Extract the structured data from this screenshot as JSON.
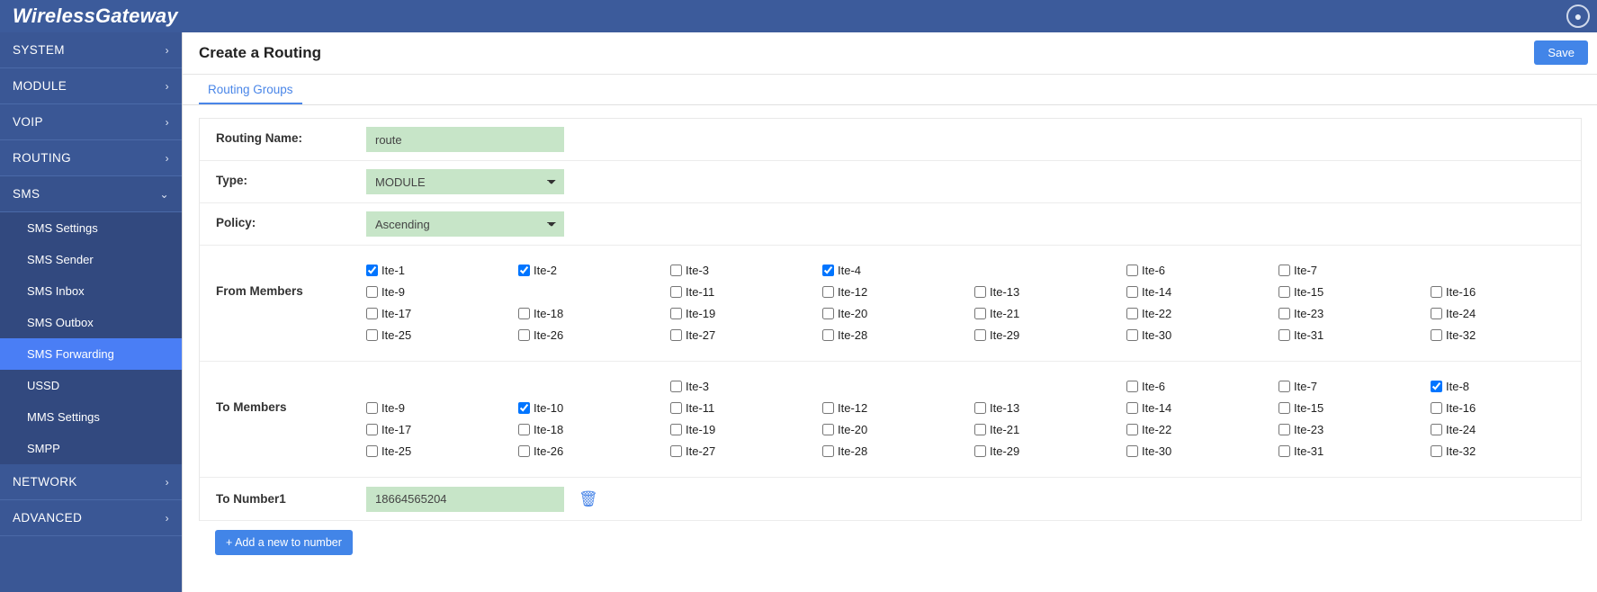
{
  "header": {
    "logo": "WirelessGateway",
    "user_icon": "user-circle-icon"
  },
  "sidebar": {
    "top_items": [
      {
        "label": "SYSTEM",
        "chevron": "›",
        "expanded": false
      },
      {
        "label": "MODULE",
        "chevron": "›",
        "expanded": false
      },
      {
        "label": "VOIP",
        "chevron": "›",
        "expanded": false
      },
      {
        "label": "ROUTING",
        "chevron": "›",
        "expanded": false
      },
      {
        "label": "SMS",
        "chevron": "⌄",
        "expanded": true
      }
    ],
    "sms_sub_items": [
      {
        "label": "SMS Settings",
        "active": false
      },
      {
        "label": "SMS Sender",
        "active": false
      },
      {
        "label": "SMS Inbox",
        "active": false
      },
      {
        "label": "SMS Outbox",
        "active": false
      },
      {
        "label": "SMS Forwarding",
        "active": true
      },
      {
        "label": "USSD",
        "active": false
      },
      {
        "label": "MMS Settings",
        "active": false
      },
      {
        "label": "SMPP",
        "active": false
      }
    ],
    "bottom_items": [
      {
        "label": "NETWORK",
        "chevron": "›"
      },
      {
        "label": "ADVANCED",
        "chevron": "›"
      }
    ]
  },
  "page": {
    "title": "Create a Routing",
    "save_label": "Save",
    "tab_label": "Routing Groups"
  },
  "form": {
    "routing_name_label": "Routing Name:",
    "routing_name_value": "route",
    "type_label": "Type:",
    "type_value": "MODULE",
    "type_options": [
      "MODULE"
    ],
    "policy_label": "Policy:",
    "policy_value": "Ascending",
    "policy_options": [
      "Ascending"
    ],
    "from_members_label": "From Members",
    "to_members_label": "To Members",
    "to_number_label": "To Number1",
    "to_number_value": "18664565204",
    "delete_icon": "trash-icon",
    "add_number_label": "+ Add a new to number"
  },
  "from_members": [
    {
      "label": "Ite-1",
      "checked": true,
      "empty": false
    },
    {
      "label": "Ite-2",
      "checked": true,
      "empty": false
    },
    {
      "label": "Ite-3",
      "checked": false,
      "empty": false
    },
    {
      "label": "Ite-4",
      "checked": true,
      "empty": false
    },
    {
      "label": "",
      "checked": false,
      "empty": true
    },
    {
      "label": "Ite-6",
      "checked": false,
      "empty": false
    },
    {
      "label": "Ite-7",
      "checked": false,
      "empty": false
    },
    {
      "label": "",
      "checked": false,
      "empty": true
    },
    {
      "label": "Ite-9",
      "checked": false,
      "empty": false
    },
    {
      "label": "",
      "checked": false,
      "empty": true
    },
    {
      "label": "Ite-11",
      "checked": false,
      "empty": false
    },
    {
      "label": "Ite-12",
      "checked": false,
      "empty": false
    },
    {
      "label": "Ite-13",
      "checked": false,
      "empty": false
    },
    {
      "label": "Ite-14",
      "checked": false,
      "empty": false
    },
    {
      "label": "Ite-15",
      "checked": false,
      "empty": false
    },
    {
      "label": "Ite-16",
      "checked": false,
      "empty": false
    },
    {
      "label": "Ite-17",
      "checked": false,
      "empty": false
    },
    {
      "label": "Ite-18",
      "checked": false,
      "empty": false
    },
    {
      "label": "Ite-19",
      "checked": false,
      "empty": false
    },
    {
      "label": "Ite-20",
      "checked": false,
      "empty": false
    },
    {
      "label": "Ite-21",
      "checked": false,
      "empty": false
    },
    {
      "label": "Ite-22",
      "checked": false,
      "empty": false
    },
    {
      "label": "Ite-23",
      "checked": false,
      "empty": false
    },
    {
      "label": "Ite-24",
      "checked": false,
      "empty": false
    },
    {
      "label": "Ite-25",
      "checked": false,
      "empty": false
    },
    {
      "label": "Ite-26",
      "checked": false,
      "empty": false
    },
    {
      "label": "Ite-27",
      "checked": false,
      "empty": false
    },
    {
      "label": "Ite-28",
      "checked": false,
      "empty": false
    },
    {
      "label": "Ite-29",
      "checked": false,
      "empty": false
    },
    {
      "label": "Ite-30",
      "checked": false,
      "empty": false
    },
    {
      "label": "Ite-31",
      "checked": false,
      "empty": false
    },
    {
      "label": "Ite-32",
      "checked": false,
      "empty": false
    }
  ],
  "to_members": [
    {
      "label": "",
      "checked": false,
      "empty": true
    },
    {
      "label": "",
      "checked": false,
      "empty": true
    },
    {
      "label": "Ite-3",
      "checked": false,
      "empty": false
    },
    {
      "label": "",
      "checked": false,
      "empty": true
    },
    {
      "label": "",
      "checked": false,
      "empty": true
    },
    {
      "label": "Ite-6",
      "checked": false,
      "empty": false
    },
    {
      "label": "Ite-7",
      "checked": false,
      "empty": false
    },
    {
      "label": "Ite-8",
      "checked": true,
      "empty": false
    },
    {
      "label": "Ite-9",
      "checked": false,
      "empty": false
    },
    {
      "label": "Ite-10",
      "checked": true,
      "empty": false
    },
    {
      "label": "Ite-11",
      "checked": false,
      "empty": false
    },
    {
      "label": "Ite-12",
      "checked": false,
      "empty": false
    },
    {
      "label": "Ite-13",
      "checked": false,
      "empty": false
    },
    {
      "label": "Ite-14",
      "checked": false,
      "empty": false
    },
    {
      "label": "Ite-15",
      "checked": false,
      "empty": false
    },
    {
      "label": "Ite-16",
      "checked": false,
      "empty": false
    },
    {
      "label": "Ite-17",
      "checked": false,
      "empty": false
    },
    {
      "label": "Ite-18",
      "checked": false,
      "empty": false
    },
    {
      "label": "Ite-19",
      "checked": false,
      "empty": false
    },
    {
      "label": "Ite-20",
      "checked": false,
      "empty": false
    },
    {
      "label": "Ite-21",
      "checked": false,
      "empty": false
    },
    {
      "label": "Ite-22",
      "checked": false,
      "empty": false
    },
    {
      "label": "Ite-23",
      "checked": false,
      "empty": false
    },
    {
      "label": "Ite-24",
      "checked": false,
      "empty": false
    },
    {
      "label": "Ite-25",
      "checked": false,
      "empty": false
    },
    {
      "label": "Ite-26",
      "checked": false,
      "empty": false
    },
    {
      "label": "Ite-27",
      "checked": false,
      "empty": false
    },
    {
      "label": "Ite-28",
      "checked": false,
      "empty": false
    },
    {
      "label": "Ite-29",
      "checked": false,
      "empty": false
    },
    {
      "label": "Ite-30",
      "checked": false,
      "empty": false
    },
    {
      "label": "Ite-31",
      "checked": false,
      "empty": false
    },
    {
      "label": "Ite-32",
      "checked": false,
      "empty": false
    }
  ],
  "colors": {
    "nav_blue": "#3a5795",
    "header_blue": "#3c5b9b",
    "active_blue": "#4a7ef5",
    "accent_blue": "#4285e8",
    "input_green": "#c7e5c8"
  }
}
